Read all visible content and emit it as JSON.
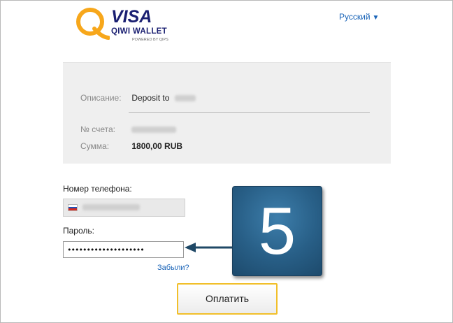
{
  "header": {
    "logo": {
      "brand": "VISA",
      "product": "QIWI WALLET",
      "powered_by": "POWERED BY QIPS",
      "icon": "qiwi-q-logo"
    },
    "language": {
      "label": "Русский",
      "dropdown_icon": "▼"
    }
  },
  "payment_info": {
    "description": {
      "label": "Описание:",
      "value": "Deposit to"
    },
    "account": {
      "label": "№ счета:"
    },
    "amount": {
      "label": "Сумма:",
      "value": "1800,00 RUB"
    }
  },
  "form": {
    "phone": {
      "label": "Номер телефона:"
    },
    "password": {
      "label": "Пароль:",
      "value": "••••••••••••••••••••"
    },
    "forgot_link": "Забыли?",
    "submit_label": "Оплатить"
  },
  "annotation": {
    "step_number": "5",
    "arrow_icon": "left-arrow"
  },
  "colors": {
    "link": "#1a64b8",
    "button_border": "#f1bf2a",
    "badge": "#285f87",
    "info_background": "#efefef",
    "qiwi_orange": "#f7a71b"
  }
}
